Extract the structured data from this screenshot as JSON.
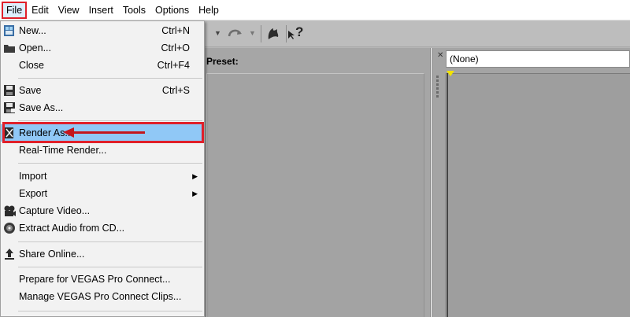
{
  "menubar": {
    "items": [
      "File",
      "Edit",
      "View",
      "Insert",
      "Tools",
      "Options",
      "Help"
    ]
  },
  "toolbar": {
    "help_glyph": "?"
  },
  "render_panel": {
    "preset_label": "Preset:"
  },
  "preview_panel": {
    "selection": "(None)"
  },
  "file_menu": {
    "items": [
      {
        "label": "New...",
        "shortcut": "Ctrl+N",
        "icon": "new-project-icon"
      },
      {
        "label": "Open...",
        "shortcut": "Ctrl+O",
        "icon": "folder-open-icon"
      },
      {
        "label": "Close",
        "shortcut": "Ctrl+F4",
        "icon": ""
      },
      {
        "label": "Save",
        "shortcut": "Ctrl+S",
        "icon": "save-icon"
      },
      {
        "label": "Save As...",
        "shortcut": "",
        "icon": "save-as-icon"
      },
      {
        "label": "Render As...",
        "shortcut": "",
        "icon": "render-icon",
        "highlighted": true
      },
      {
        "label": "Real-Time Render...",
        "shortcut": "",
        "icon": ""
      },
      {
        "label": "Import",
        "shortcut": "",
        "icon": "",
        "submenu": true
      },
      {
        "label": "Export",
        "shortcut": "",
        "icon": "",
        "submenu": true
      },
      {
        "label": "Capture Video...",
        "shortcut": "",
        "icon": "camera-icon"
      },
      {
        "label": "Extract Audio from CD...",
        "shortcut": "",
        "icon": "cd-icon"
      },
      {
        "label": "Share Online...",
        "shortcut": "",
        "icon": "share-upload-icon"
      },
      {
        "label": "Prepare for VEGAS Pro Connect...",
        "shortcut": "",
        "icon": ""
      },
      {
        "label": "Manage VEGAS Pro Connect Clips...",
        "shortcut": "",
        "icon": ""
      }
    ]
  },
  "colors": {
    "highlight": "#90c8f6",
    "annotation_red": "#e0202a"
  }
}
